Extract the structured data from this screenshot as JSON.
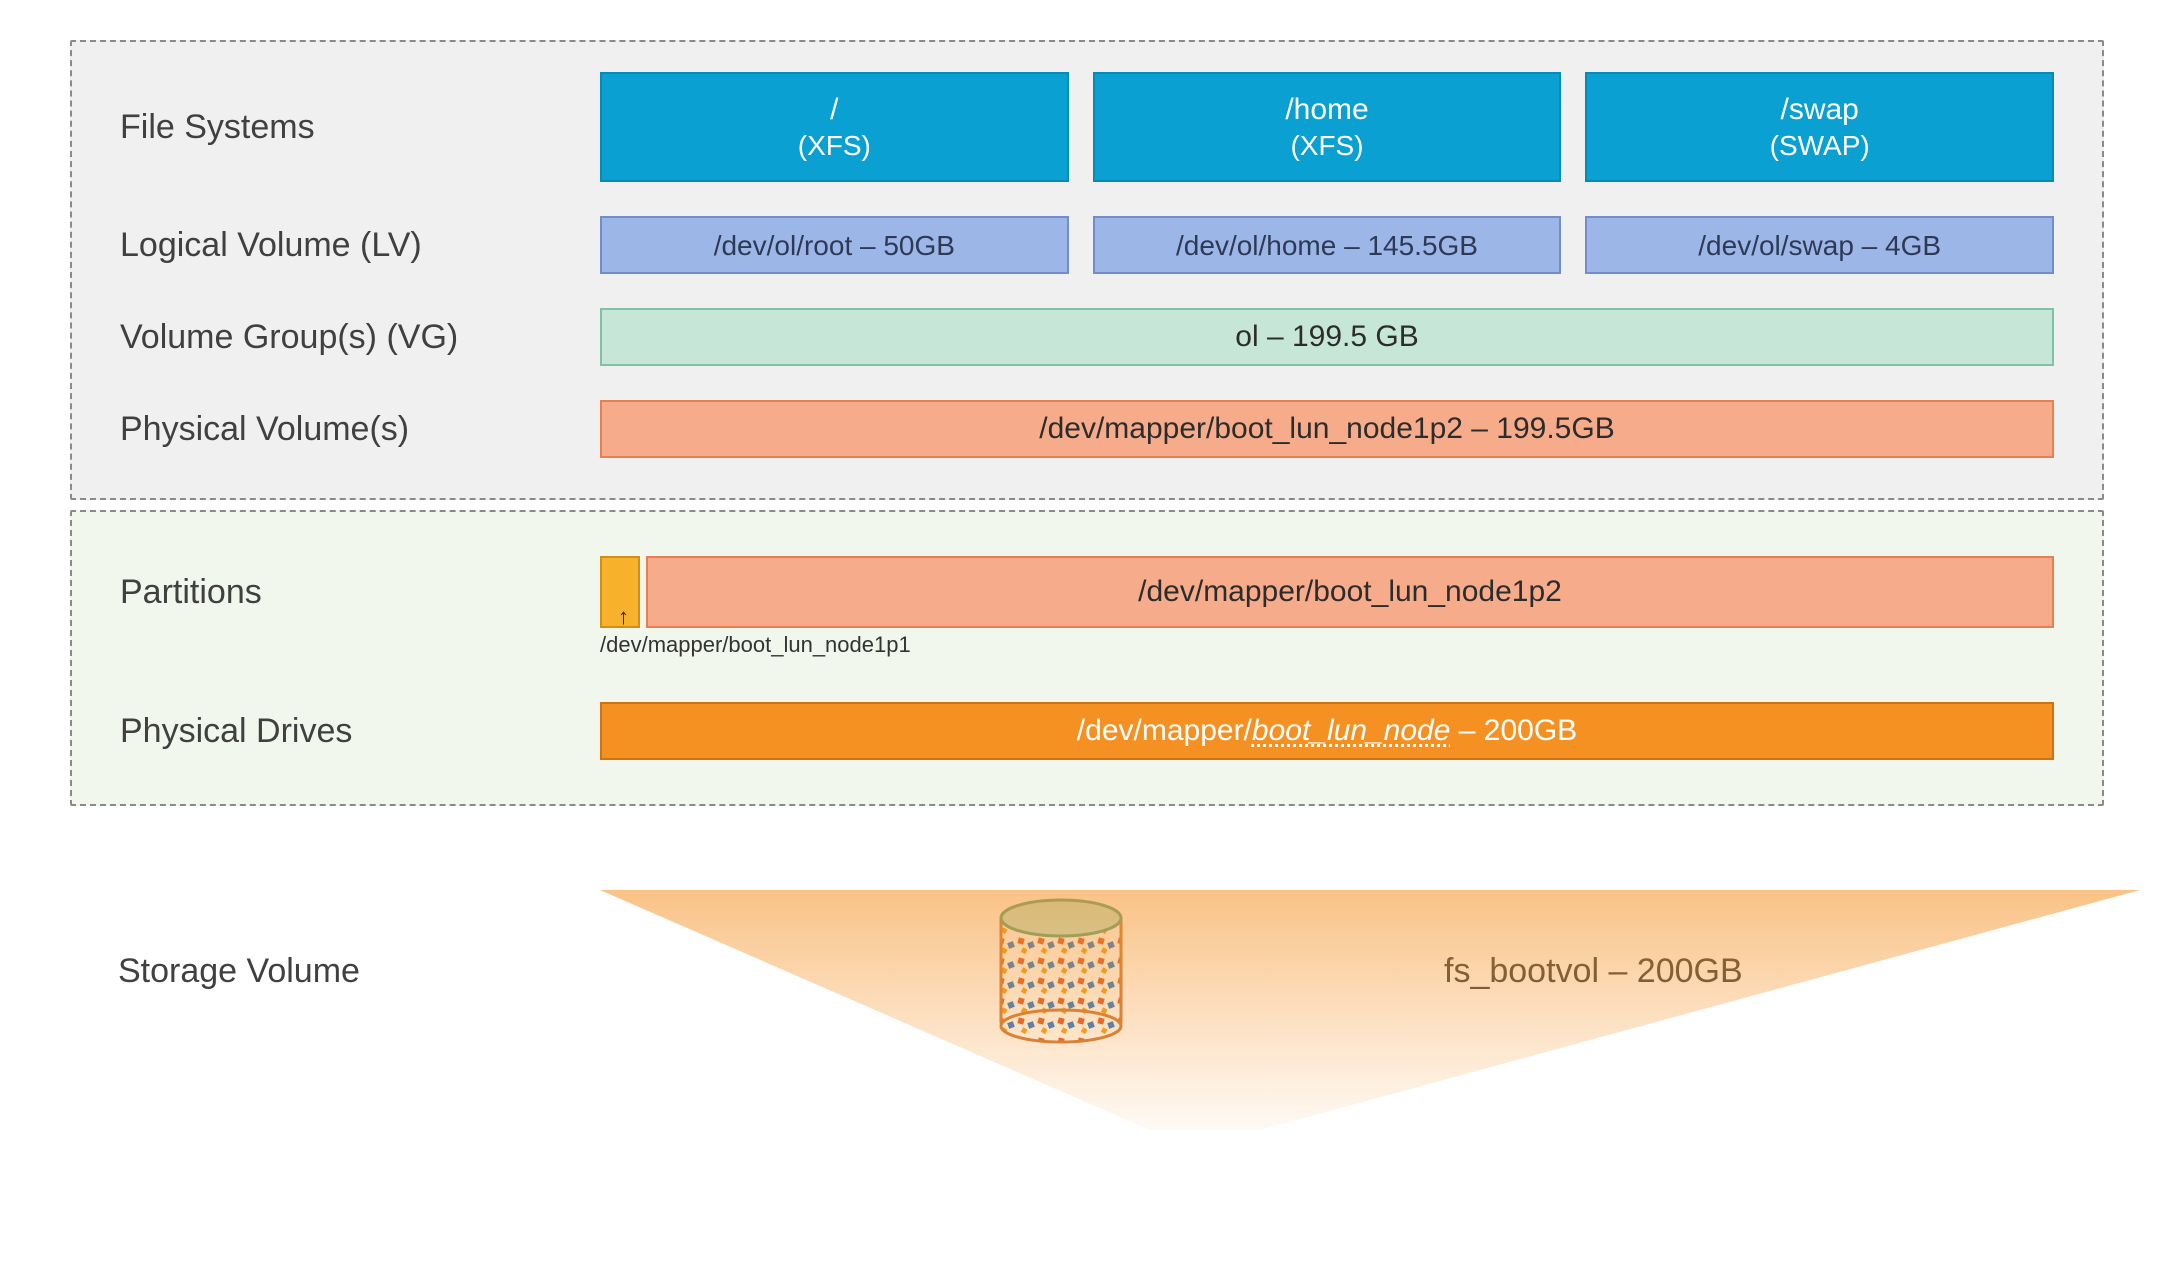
{
  "labels": {
    "file_systems": "File Systems",
    "logical_volume": "Logical Volume (LV)",
    "volume_group": "Volume Group(s) (VG)",
    "physical_volume": "Physical Volume(s)",
    "partitions": "Partitions",
    "physical_drives": "Physical Drives",
    "storage_volume": "Storage Volume"
  },
  "file_systems": [
    {
      "mount": "/",
      "type": "(XFS)"
    },
    {
      "mount": "/home",
      "type": "(XFS)"
    },
    {
      "mount": "/swap",
      "type": "(SWAP)"
    }
  ],
  "logical_volumes": [
    {
      "label": "/dev/ol/root – 50GB"
    },
    {
      "label": "/dev/ol/home – 145.5GB"
    },
    {
      "label": "/dev/ol/swap – 4GB"
    }
  ],
  "volume_group": {
    "label": "ol – 199.5 GB"
  },
  "physical_volume": {
    "label": "/dev/mapper/boot_lun_node1p2 – 199.5GB"
  },
  "partitions": {
    "p1_annotation": "/dev/mapper/boot_lun_node1p1",
    "p2_label": "/dev/mapper/boot_lun_node1p2"
  },
  "physical_drive": {
    "prefix": "/dev/mapper/",
    "name": "boot_lun_node",
    "suffix": " – 200GB"
  },
  "storage_volume": {
    "label": "fs_bootvol – 200GB"
  },
  "colors": {
    "fs": "#0aa0d1",
    "lv": "#9cb7e7",
    "vg": "#c6e6d8",
    "pv": "#f6ac8b",
    "partition_small": "#f7b12b",
    "drive": "#f59123"
  }
}
